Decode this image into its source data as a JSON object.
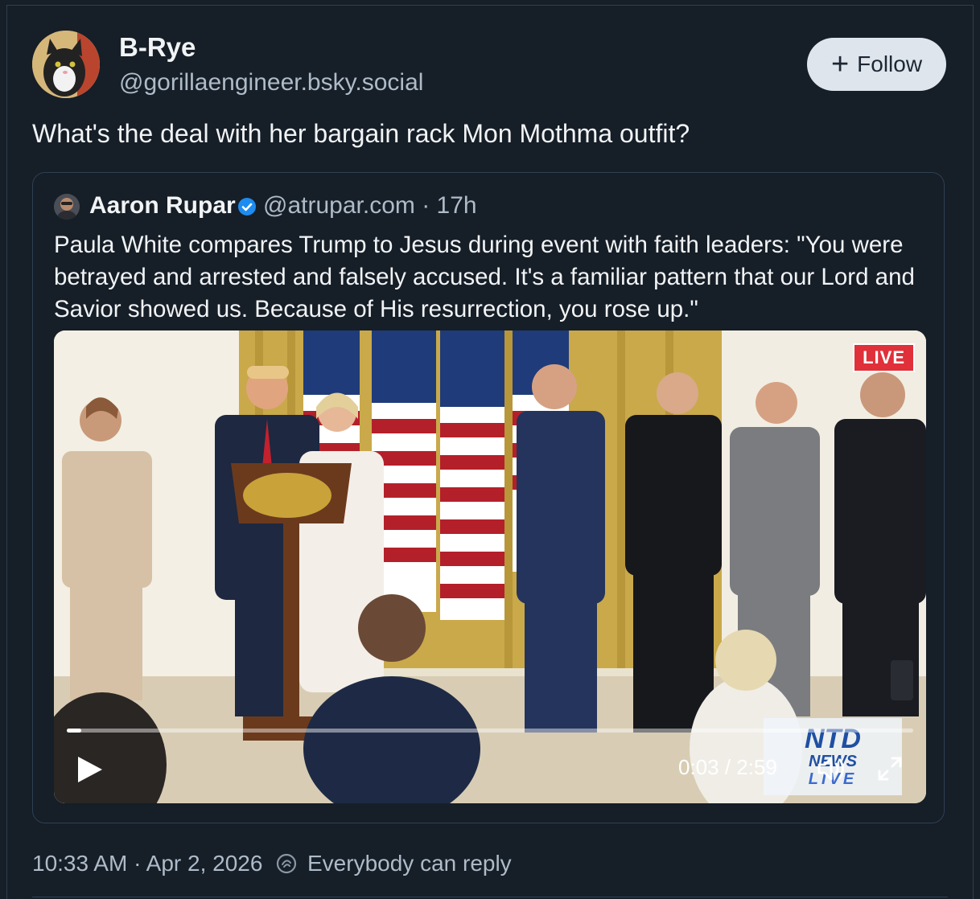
{
  "post": {
    "author_name": "B-Rye",
    "author_handle": "@gorillaengineer.bsky.social",
    "follow_label": "Follow",
    "text": "What's the deal with her bargain rack Mon Mothma outfit?",
    "timestamp": "10:33 AM · Apr 2, 2026",
    "reply_setting": "Everybody can reply"
  },
  "quote": {
    "author_name": "Aaron Rupar",
    "author_meta": "@atrupar.com · 17h",
    "verified": true,
    "text": "Paula White compares Trump to Jesus during event with faith leaders: \"You were betrayed and arrested and falsely accused. It's a familiar pattern that our Lord and Savior showed us. Because of His resurrection, you rose up.\""
  },
  "video": {
    "live_badge": "LIVE",
    "logo_line1": "NTD",
    "logo_line2": "NEWS",
    "logo_line3": "LIVE",
    "time_display": "0:03 / 2:59",
    "progress": 0.017
  },
  "colors": {
    "background": "#161e27",
    "border": "#2e4052",
    "muted_text": "#aebbc9",
    "follow_bg": "#dfe5ec",
    "verified": "#1d8cf0"
  },
  "icons": [
    "cat-avatar",
    "user-avatar",
    "verified-check-icon",
    "plus-icon",
    "play-icon",
    "volume-icon",
    "fullscreen-icon",
    "reply-settings-icon"
  ]
}
